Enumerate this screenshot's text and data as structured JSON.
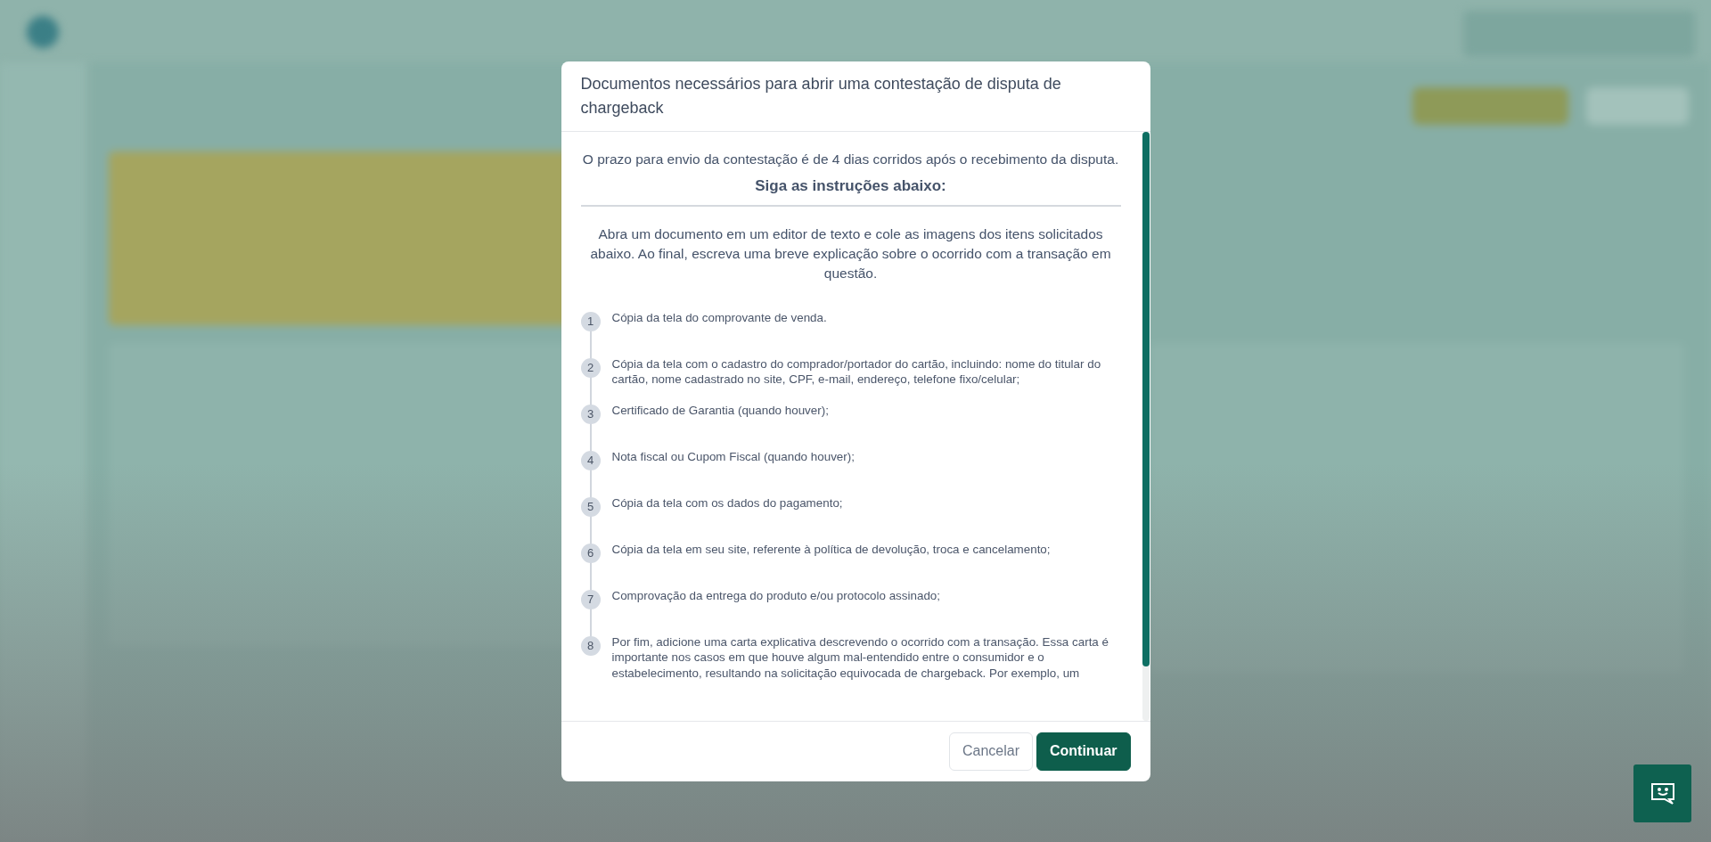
{
  "modal": {
    "title": "Documentos necessários para abrir uma contestação de disputa de chargeback",
    "deadline": "O prazo para envio da contestação é de 4 dias corridos após o recebimento da disputa.",
    "heading": "Siga as instruções abaixo:",
    "instructions": "Abra um documento em um editor de texto e cole as imagens dos itens solicitados abaixo. Ao final, escreva uma breve explicação sobre o ocorrido com a transação em questão.",
    "steps": [
      {
        "number": "1",
        "text": "Cópia da tela do comprovante de venda."
      },
      {
        "number": "2",
        "text": "Cópia da tela com o cadastro do comprador/portador do cartão, incluindo: nome do titular do cartão, nome cadastrado no site, CPF, e-mail, endereço, telefone fixo/celular;"
      },
      {
        "number": "3",
        "text": "Certificado de Garantia (quando houver);"
      },
      {
        "number": "4",
        "text": "Nota fiscal ou Cupom Fiscal (quando houver);"
      },
      {
        "number": "5",
        "text": "Cópia da tela com os dados do pagamento;"
      },
      {
        "number": "6",
        "text": "Cópia da tela em seu site, referente à política de devolução, troca e cancelamento;"
      },
      {
        "number": "7",
        "text": "Comprovação da entrega do produto e/ou protocolo assinado;"
      },
      {
        "number": "8",
        "text": "Por fim, adicione uma carta explicativa descrevendo o ocorrido com a transação. Essa carta é importante nos casos em que houve algum mal-entendido entre o consumidor e o estabelecimento, resultando na solicitação equivocada de chargeback. Por exemplo, um"
      }
    ],
    "buttons": [
      {
        "label": "Cancelar",
        "kind": "secondary"
      },
      {
        "label": "Continuar",
        "kind": "primary"
      }
    ]
  }
}
